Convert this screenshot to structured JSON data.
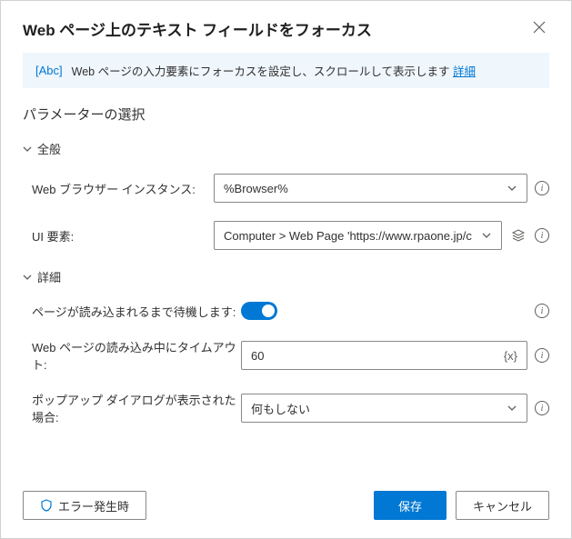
{
  "header": {
    "title": "Web ページ上のテキスト フィールドをフォーカス"
  },
  "banner": {
    "text": "Web ページの入力要素にフォーカスを設定し、スクロールして表示します ",
    "link": "詳細"
  },
  "section_title": "パラメーターの選択",
  "groups": {
    "general": {
      "label": "全般",
      "browser_label": "Web ブラウザー インスタンス:",
      "browser_value": "%Browser%",
      "ui_label": "UI 要素:",
      "ui_value": "Computer > Web Page 'https://www.rpaone.jp/c"
    },
    "advanced": {
      "label": "詳細",
      "wait_label": "ページが読み込まれるまで待機します:",
      "timeout_label": "Web ページの読み込み中にタイムアウト:",
      "timeout_value": "60",
      "popup_label": "ポップアップ ダイアログが表示された場合:",
      "popup_value": "何もしない"
    }
  },
  "footer": {
    "on_error": "エラー発生時",
    "save": "保存",
    "cancel": "キャンセル"
  }
}
